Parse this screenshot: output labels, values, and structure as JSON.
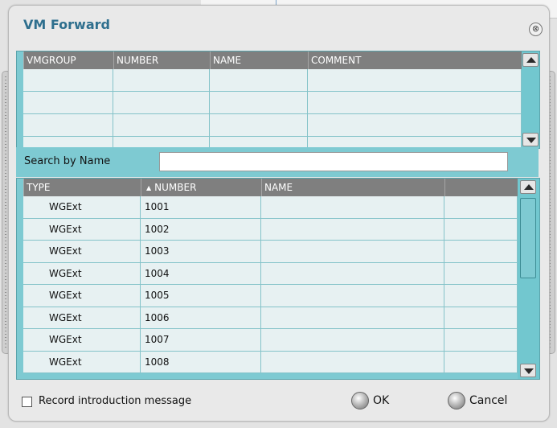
{
  "dialog": {
    "title": "VM Forward",
    "close_glyph": "⊗"
  },
  "top_grid": {
    "columns": [
      "VMGROUP",
      "NUMBER",
      "NAME",
      "COMMENT"
    ],
    "row_count": 4
  },
  "search": {
    "label": "Search by Name",
    "value": "",
    "placeholder": ""
  },
  "bottom_grid": {
    "columns": [
      "TYPE",
      "NUMBER",
      "NAME",
      ""
    ],
    "sorted_column": "NUMBER",
    "sort_glyph": "▲",
    "rows": [
      {
        "type": "WGExt",
        "number": "1001",
        "name": "",
        "extra": ""
      },
      {
        "type": "WGExt",
        "number": "1002",
        "name": "",
        "extra": ""
      },
      {
        "type": "WGExt",
        "number": "1003",
        "name": "",
        "extra": ""
      },
      {
        "type": "WGExt",
        "number": "1004",
        "name": "",
        "extra": ""
      },
      {
        "type": "WGExt",
        "number": "1005",
        "name": "",
        "extra": ""
      },
      {
        "type": "WGExt",
        "number": "1006",
        "name": "",
        "extra": ""
      },
      {
        "type": "WGExt",
        "number": "1007",
        "name": "",
        "extra": ""
      },
      {
        "type": "WGExt",
        "number": "1008",
        "name": "",
        "extra": ""
      }
    ]
  },
  "footer": {
    "record_intro_label": "Record introduction message",
    "record_intro_checked": false,
    "ok_label": "OK",
    "cancel_label": "Cancel"
  },
  "colors": {
    "title": "#2e6f8e",
    "header_bg": "#7f7f7f",
    "teal_panel": "#7ecad2",
    "row_bg": "#e7f1f2"
  },
  "icons": [
    "close-icon",
    "scroll-up-icon",
    "scroll-down-icon",
    "sort-ascending-icon",
    "ok-orb-icon",
    "cancel-orb-icon"
  ]
}
